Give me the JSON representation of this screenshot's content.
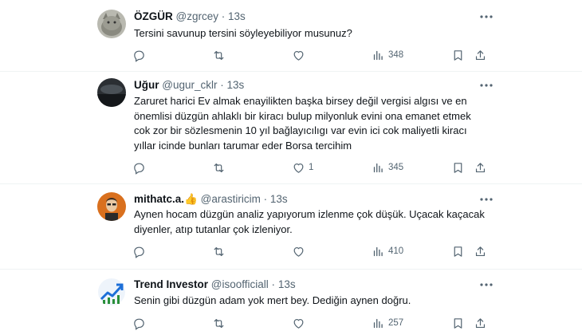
{
  "tweets": [
    {
      "name": "ÖZGÜR",
      "handle": "@zgrcey",
      "dot": "·",
      "time": "13s",
      "text": "Tersini savunup tersini söyleyebiliyor musunuz?",
      "replies": "",
      "retweets": "",
      "likes": "",
      "views": "348",
      "avatar": "cat-photo"
    },
    {
      "name": "Uğur",
      "handle": "@ugur_cklr",
      "dot": "·",
      "time": "13s",
      "text": "Zaruret harici Ev almak enayilikten başka birsey değil vergisi algısı ve en önemlisi düzgün ahlaklı bir kiracı bulup milyonluk evini ona emanet etmek cok zor bir sözlesmenin 10 yıl bağlayıcılıgı var evin ici cok maliyetli kiracı yıllar icinde bunları tarumar eder   Borsa tercihim",
      "replies": "",
      "retweets": "",
      "likes": "1",
      "views": "345",
      "avatar": "dark-landscape"
    },
    {
      "name": "mithatc.a.",
      "emoji": "👍",
      "handle": "@arastiricim",
      "dot": "·",
      "time": "13s",
      "text": "Aynen hocam düzgün analiz yapıyorum izlenme çok düşük.  Uçacak kaçacak diyenler, atıp tutanlar çok izleniyor.",
      "replies": "",
      "retweets": "",
      "likes": "",
      "views": "410",
      "avatar": "person-orange"
    },
    {
      "name": "Trend Investor",
      "handle": "@isoofficiall",
      "dot": "·",
      "time": "13s",
      "text": "Senin gibi düzgün adam yok mert bey. Dediğin aynen doğru.",
      "replies": "",
      "retweets": "",
      "likes": "",
      "views": "257",
      "avatar": "chart-logo"
    }
  ],
  "colors": {
    "text": "#0f1419",
    "secondary": "#536471",
    "divider": "#eff3f4",
    "emoji": "#f4c534"
  },
  "icons": [
    "reply-icon",
    "retweet-icon",
    "like-icon",
    "views-icon",
    "bookmark-icon",
    "share-icon",
    "more-icon"
  ]
}
